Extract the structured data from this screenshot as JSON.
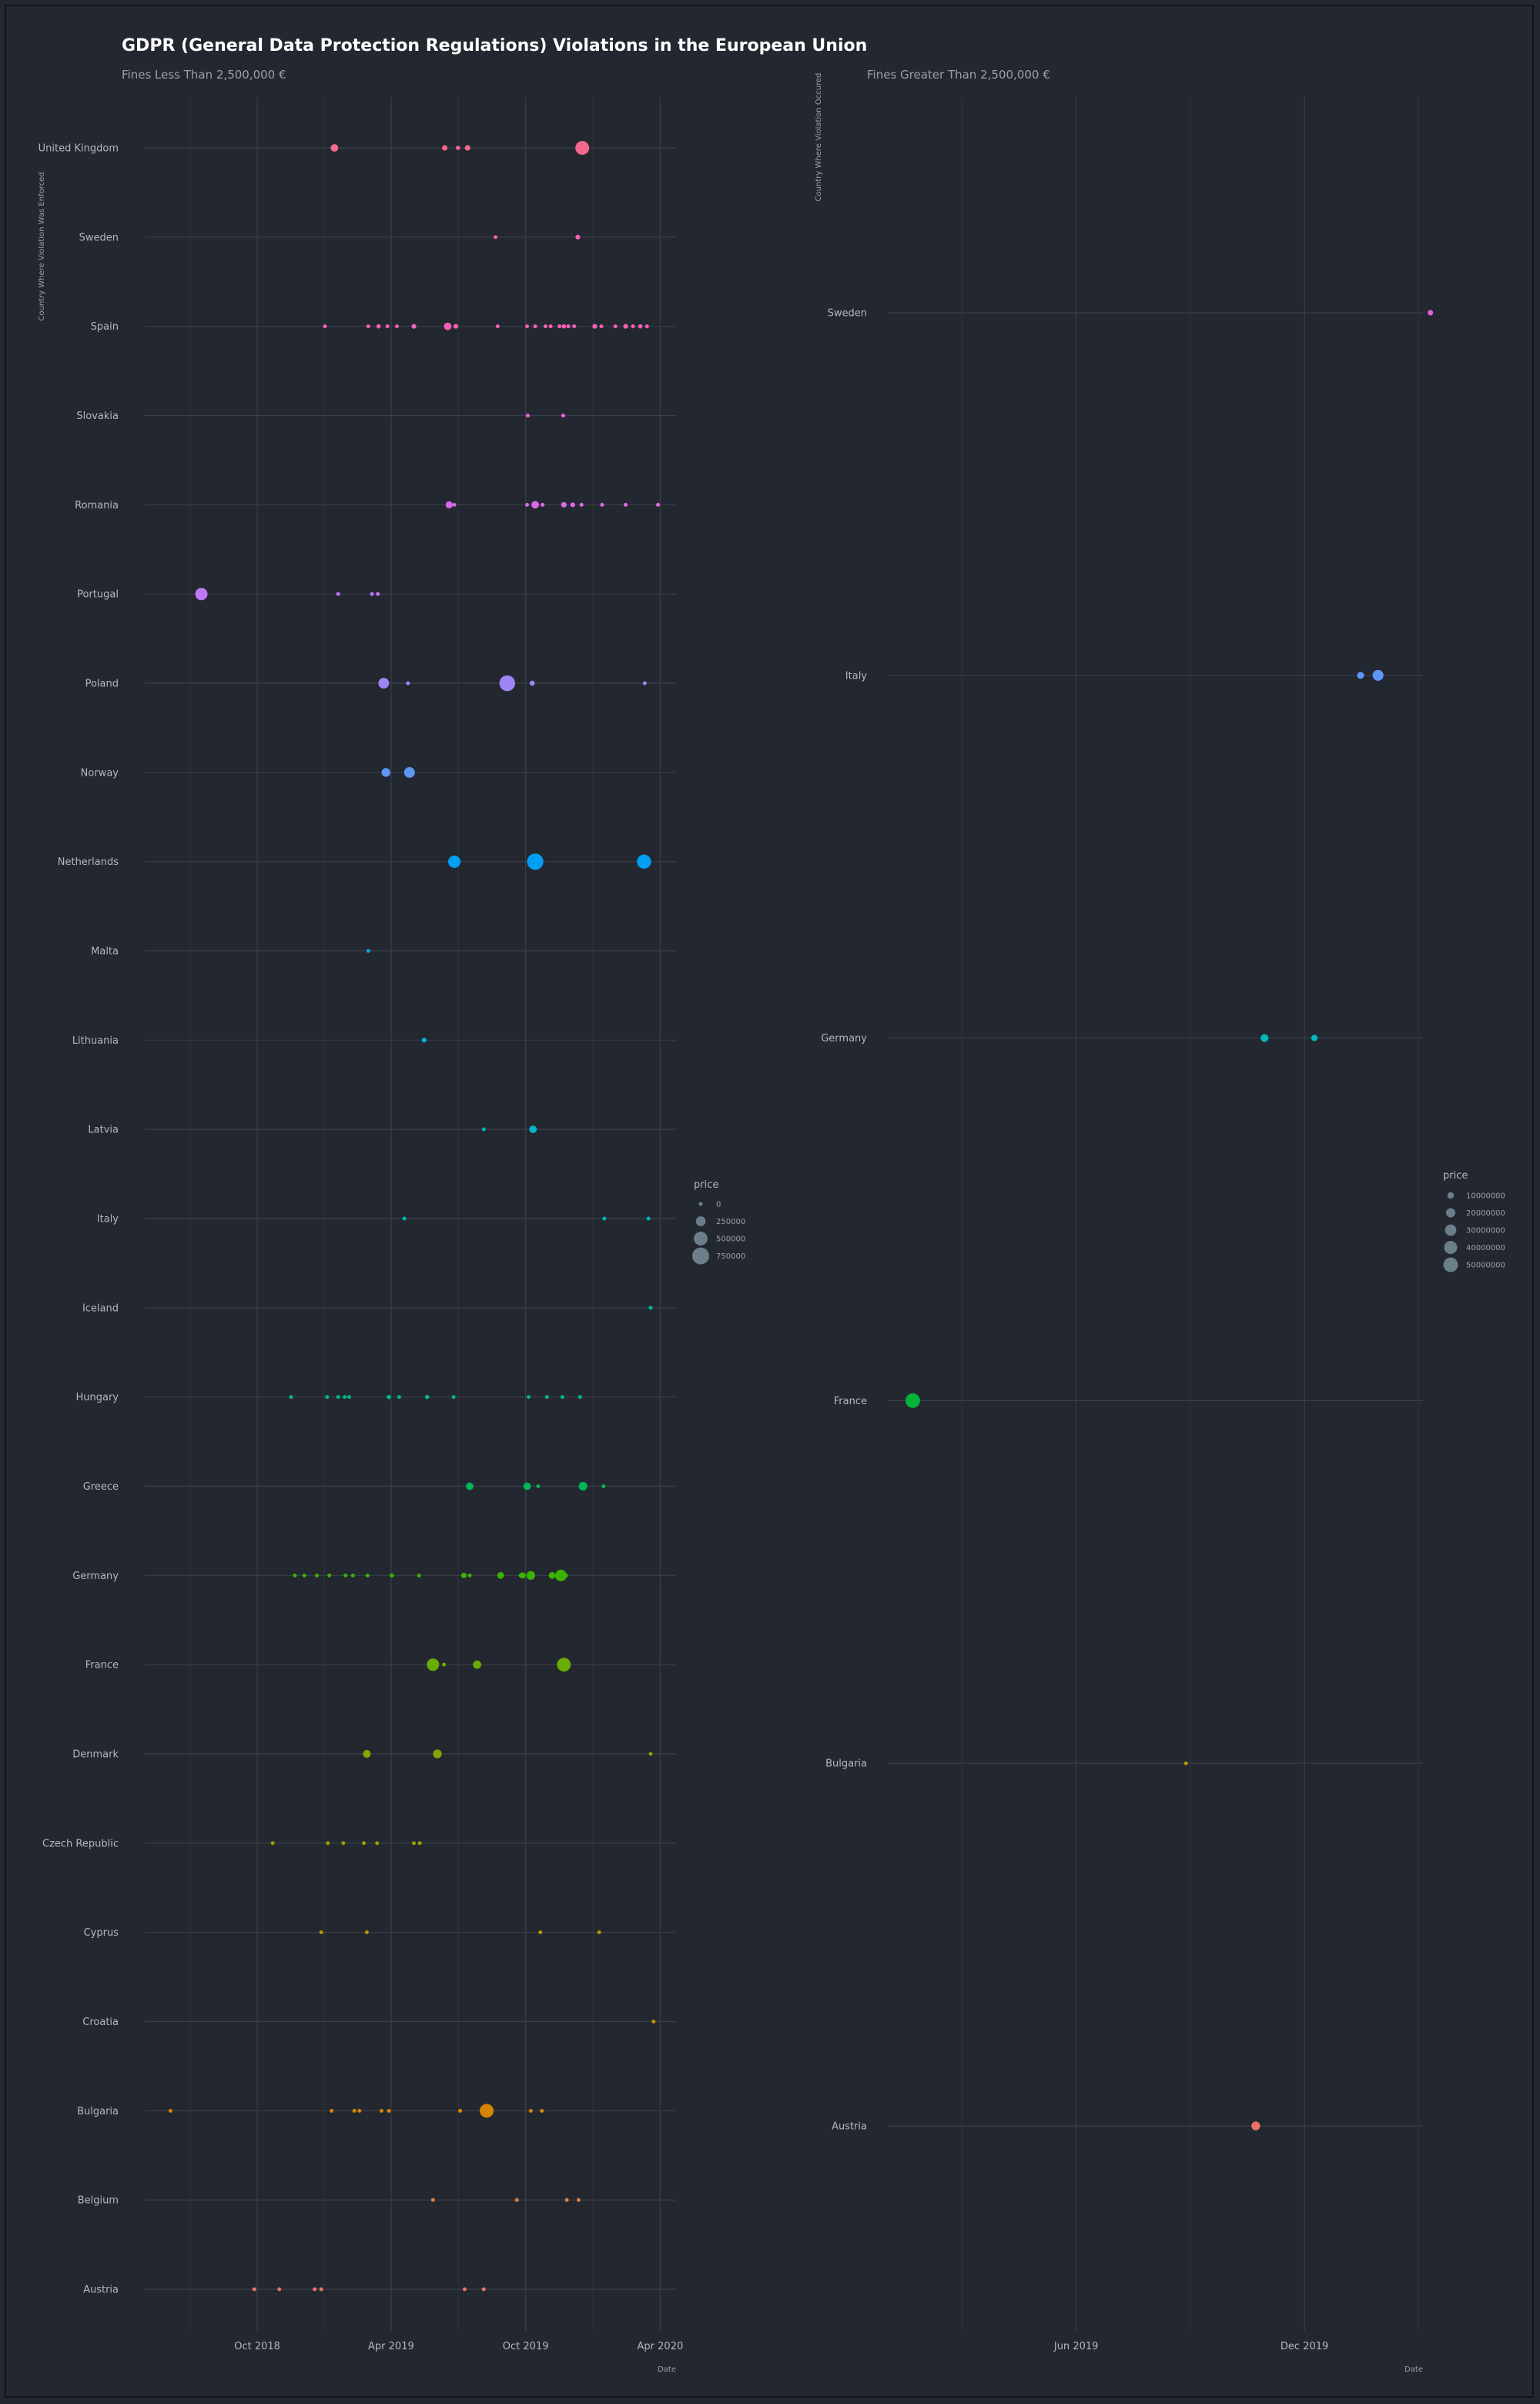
{
  "title": "GDPR (General Data Protection Regulations) Violations in the European Union",
  "chart_data": [
    {
      "type": "scatter",
      "subtitle": "Fines Less Than 2,500,000 €",
      "ylabel": "Country Where Violation Was Enforced",
      "xlabel": "Date",
      "x_ticks": [
        "2018-10-01",
        "2019-04-01",
        "2019-10-01",
        "2020-04-01"
      ],
      "x_tick_labels": [
        "Oct 2018",
        "Apr 2019",
        "Oct 2019",
        "Apr 2020"
      ],
      "x_range": [
        "2018-05-01",
        "2020-04-10"
      ],
      "size_legend": {
        "title": "price",
        "values": [
          0,
          250000,
          500000,
          750000
        ]
      },
      "categories": [
        "Austria",
        "Belgium",
        "Bulgaria",
        "Croatia",
        "Cyprus",
        "Czech Republic",
        "Denmark",
        "France",
        "Germany",
        "Greece",
        "Hungary",
        "Iceland",
        "Italy",
        "Latvia",
        "Lithuania",
        "Malta",
        "Netherlands",
        "Norway",
        "Poland",
        "Portugal",
        "Romania",
        "Slovakia",
        "Spain",
        "Sweden",
        "United Kingdom"
      ],
      "colors": [
        "#f8766d",
        "#ef7f4a",
        "#e38900",
        "#d39200",
        "#c09b00",
        "#a9a300",
        "#8fa900",
        "#6eb300",
        "#3cb800",
        "#00bc56",
        "#00c081",
        "#00c19f",
        "#00c0b8",
        "#00bdd0",
        "#00b7e4",
        "#00aef6",
        "#00a5ff",
        "#619cff",
        "#a58aff",
        "#c77cff",
        "#e36ef6",
        "#f564e3",
        "#ff62bc",
        "#ff63b6",
        "#ff6c91"
      ],
      "points": {
        "Austria": [
          [
            "2018-09-27",
            2000
          ],
          [
            "2018-10-31",
            3000
          ],
          [
            "2018-12-18",
            5000
          ],
          [
            "2018-12-27",
            4500
          ],
          [
            "2019-07-10",
            20000
          ],
          [
            "2019-08-05",
            40000
          ]
        ],
        "Belgium": [
          [
            "2019-05-28",
            5000
          ],
          [
            "2019-09-19",
            10000
          ],
          [
            "2019-11-26",
            20000
          ],
          [
            "2019-12-12",
            25000
          ]
        ],
        "Bulgaria": [
          [
            "2018-06-05",
            2000
          ],
          [
            "2019-01-10",
            5000
          ],
          [
            "2019-02-10",
            6000
          ],
          [
            "2019-02-17",
            4000
          ],
          [
            "2019-03-19",
            8000
          ],
          [
            "2019-03-29",
            5000
          ],
          [
            "2019-07-04",
            10000
          ],
          [
            "2019-08-09",
            500000
          ],
          [
            "2019-10-08",
            6000
          ],
          [
            "2019-10-23",
            5000
          ]
        ],
        "Croatia": [
          [
            "2020-03-23",
            2000
          ]
        ],
        "Cyprus": [
          [
            "2018-12-27",
            15000
          ],
          [
            "2019-02-27",
            15000
          ],
          [
            "2019-10-21",
            15000
          ],
          [
            "2020-01-09",
            10000
          ]
        ],
        "Czech Republic": [
          [
            "2018-10-22",
            2000
          ],
          [
            "2019-01-05",
            3000
          ],
          [
            "2019-01-26",
            3000
          ],
          [
            "2019-02-23",
            4500
          ],
          [
            "2019-03-13",
            5000
          ],
          [
            "2019-05-02",
            6000
          ],
          [
            "2019-05-10",
            4000
          ]
        ],
        "Denmark": [
          [
            "2019-02-27",
            160000
          ],
          [
            "2019-06-03",
            200000
          ],
          [
            "2020-03-19",
            20000
          ]
        ],
        "France": [
          [
            "2019-05-28",
            400000
          ],
          [
            "2019-06-12",
            20000
          ],
          [
            "2019-07-27",
            180000
          ],
          [
            "2019-11-22",
            500000
          ]
        ],
        "Germany": [
          [
            "2018-11-21",
            20000
          ],
          [
            "2018-12-04",
            20000
          ],
          [
            "2018-12-21",
            15000
          ],
          [
            "2019-01-07",
            30000
          ],
          [
            "2019-01-29",
            15000
          ],
          [
            "2019-02-08",
            20000
          ],
          [
            "2019-02-28",
            25000
          ],
          [
            "2019-04-02",
            50000
          ],
          [
            "2019-05-09",
            10000
          ],
          [
            "2019-07-09",
            80000
          ],
          [
            "2019-07-17",
            20000
          ],
          [
            "2019-08-28",
            120000
          ],
          [
            "2019-09-24",
            20000
          ],
          [
            "2019-09-27",
            100000
          ],
          [
            "2019-10-08",
            200000
          ],
          [
            "2019-11-06",
            120000
          ],
          [
            "2019-11-18",
            350000
          ],
          [
            "2019-11-25",
            20000
          ]
        ],
        "Greece": [
          [
            "2019-07-17",
            150000
          ],
          [
            "2019-10-03",
            150000
          ],
          [
            "2019-10-18",
            20000
          ],
          [
            "2019-12-18",
            200000
          ],
          [
            "2020-01-15",
            20000
          ]
        ],
        "Hungary": [
          [
            "2018-11-16",
            5000
          ],
          [
            "2019-01-04",
            3000
          ],
          [
            "2019-01-19",
            5000
          ],
          [
            "2019-01-28",
            10000
          ],
          [
            "2019-02-03",
            20000
          ],
          [
            "2019-03-29",
            50000
          ],
          [
            "2019-04-12",
            30000
          ],
          [
            "2019-05-20",
            50000
          ],
          [
            "2019-06-25",
            30000
          ],
          [
            "2019-10-05",
            20000
          ],
          [
            "2019-10-30",
            20000
          ],
          [
            "2019-11-20",
            15000
          ],
          [
            "2019-12-14",
            3000
          ]
        ],
        "Iceland": [
          [
            "2020-03-19",
            10000
          ]
        ],
        "Italy": [
          [
            "2019-04-19",
            30000
          ],
          [
            "2020-01-16",
            30000
          ],
          [
            "2020-03-16",
            30000
          ]
        ],
        "Latvia": [
          [
            "2019-08-05",
            7000
          ],
          [
            "2019-10-11",
            150000
          ]
        ],
        "Lithuania": [
          [
            "2019-05-16",
            60000
          ]
        ],
        "Malta": [
          [
            "2019-03-01",
            5000
          ]
        ],
        "Netherlands": [
          [
            "2019-06-26",
            400000
          ],
          [
            "2019-10-14",
            700000
          ],
          [
            "2020-03-10",
            525000
          ]
        ],
        "Norway": [
          [
            "2019-03-25",
            200000
          ],
          [
            "2019-04-26",
            300000
          ]
        ],
        "Poland": [
          [
            "2019-03-22",
            300000
          ],
          [
            "2019-04-24",
            10000
          ],
          [
            "2019-09-06",
            650000
          ],
          [
            "2019-10-10",
            70000
          ],
          [
            "2020-03-11",
            10000
          ]
        ],
        "Portugal": [
          [
            "2018-07-17",
            400000
          ],
          [
            "2019-01-19",
            25000
          ],
          [
            "2019-03-06",
            5000
          ],
          [
            "2019-03-14",
            3000
          ]
        ],
        "Romania": [
          [
            "2019-06-19",
            130000
          ],
          [
            "2019-06-26",
            30000
          ],
          [
            "2019-10-03",
            20000
          ],
          [
            "2019-10-14",
            150000
          ],
          [
            "2019-10-24",
            40000
          ],
          [
            "2019-11-22",
            80000
          ],
          [
            "2019-12-04",
            60000
          ],
          [
            "2019-12-16",
            40000
          ],
          [
            "2020-01-13",
            20000
          ],
          [
            "2020-02-14",
            15000
          ],
          [
            "2020-03-29",
            20000
          ]
        ],
        "Slovakia": [
          [
            "2019-10-04",
            40000
          ],
          [
            "2019-11-21",
            40000
          ]
        ],
        "Spain": [
          [
            "2019-01-01",
            10000
          ],
          [
            "2019-03-01",
            30000
          ],
          [
            "2019-03-15",
            50000
          ],
          [
            "2019-03-27",
            40000
          ],
          [
            "2019-04-09",
            30000
          ],
          [
            "2019-05-02",
            60000
          ],
          [
            "2019-06-17",
            150000
          ],
          [
            "2019-06-28",
            60000
          ],
          [
            "2019-08-24",
            30000
          ],
          [
            "2019-10-03",
            15000
          ],
          [
            "2019-10-14",
            40000
          ],
          [
            "2019-10-28",
            30000
          ],
          [
            "2019-11-04",
            35000
          ],
          [
            "2019-11-16",
            40000
          ],
          [
            "2019-11-22",
            50000
          ],
          [
            "2019-11-28",
            40000
          ],
          [
            "2019-12-06",
            30000
          ],
          [
            "2020-01-03",
            60000
          ],
          [
            "2020-01-12",
            30000
          ],
          [
            "2020-01-31",
            40000
          ],
          [
            "2020-02-14",
            60000
          ],
          [
            "2020-02-24",
            40000
          ],
          [
            "2020-03-05",
            50000
          ],
          [
            "2020-03-14",
            40000
          ]
        ],
        "Sweden": [
          [
            "2019-08-21",
            30000
          ],
          [
            "2019-12-11",
            60000
          ]
        ],
        "United Kingdom": [
          [
            "2019-01-14",
            150000
          ],
          [
            "2019-06-13",
            80000
          ],
          [
            "2019-07-01",
            50000
          ],
          [
            "2019-07-14",
            80000
          ],
          [
            "2019-12-17",
            500000
          ]
        ]
      }
    },
    {
      "type": "scatter",
      "subtitle": "Fines Greater Than 2,500,000 €",
      "ylabel": "Country Where Violation Occured",
      "xlabel": "Date",
      "x_ticks": [
        "2019-06-01",
        "2019-12-01"
      ],
      "x_tick_labels": [
        "Jun 2019",
        "Dec 2019"
      ],
      "x_range": [
        "2019-01-01",
        "2020-03-05"
      ],
      "size_legend": {
        "title": "price",
        "values": [
          10000000,
          20000000,
          30000000,
          40000000,
          50000000
        ]
      },
      "categories": [
        "Austria",
        "Bulgaria",
        "France",
        "Germany",
        "Italy",
        "Sweden"
      ],
      "colors": [
        "#f8766d",
        "#b79f00",
        "#00ba38",
        "#00bfc4",
        "#619cff",
        "#f564e3"
      ],
      "points": {
        "Austria": [
          [
            "2019-10-23",
            18000000
          ]
        ],
        "Bulgaria": [
          [
            "2019-08-28",
            2600000
          ]
        ],
        "France": [
          [
            "2019-01-21",
            50000000
          ]
        ],
        "Germany": [
          [
            "2019-10-30",
            14500000
          ],
          [
            "2019-12-09",
            9550000
          ]
        ],
        "Italy": [
          [
            "2020-01-15",
            11500000
          ],
          [
            "2020-01-29",
            27800000
          ]
        ],
        "Sweden": [
          [
            "2020-03-11",
            7000000
          ]
        ]
      }
    }
  ]
}
